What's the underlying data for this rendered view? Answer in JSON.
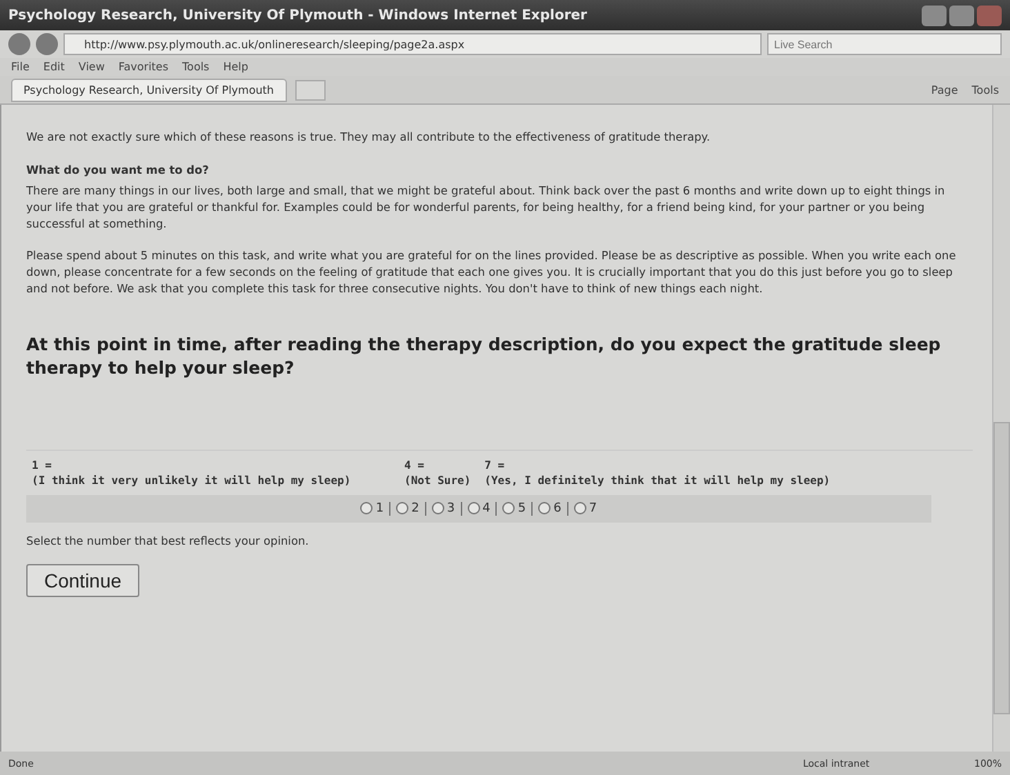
{
  "window": {
    "title": "Psychology Research, University Of Plymouth - Windows Internet Explorer"
  },
  "address_bar": {
    "url": "http://www.psy.plymouth.ac.uk/onlineresearch/sleeping/page2a.aspx",
    "search_placeholder": "Live Search"
  },
  "menu": [
    "File",
    "Edit",
    "View",
    "Favorites",
    "Tools",
    "Help"
  ],
  "tabs": [
    {
      "label": "Psychology Research, University Of Plymouth",
      "selected": true
    }
  ],
  "commands": [
    "Page",
    "Tools"
  ],
  "content": {
    "paragraph_1": "We are not exactly sure which of these reasons is true. They may all contribute to the effectiveness of gratitude therapy.",
    "heading": "What do you want me to do?",
    "paragraph_2": "There are many things in our lives, both large and small, that we might be grateful about. Think back over the past 6 months and write down up to eight things in your life that you are grateful or thankful for. Examples could be for wonderful parents, for being healthy, for a friend being kind, for your partner or you being successful at something.",
    "paragraph_3": "Please spend about 5 minutes on this task, and write what you are grateful for on the lines provided. Please be as descriptive as possible. When you write each one down, please concentrate for a few seconds on the feeling of gratitude that each one gives you. It is crucially important that you do this just before you go to sleep and not before. We ask that you complete this task for three consecutive nights. You don't have to think of new things each night.",
    "question": "At this point in time, after reading the therapy description, do you expect the gratitude sleep therapy to help your sleep?",
    "scale_anchors": [
      {
        "number": "1 =",
        "label": "(I think it very unlikely it will help my sleep)"
      },
      {
        "number": "4 =",
        "label": "(Not Sure)"
      },
      {
        "number": "7 =",
        "label": "(Yes, I definitely think that it will help my sleep)"
      }
    ],
    "options": [
      {
        "label": "1",
        "selected": false
      },
      {
        "label": "2",
        "selected": false
      },
      {
        "label": "3",
        "selected": false
      },
      {
        "label": "4",
        "selected": false
      },
      {
        "label": "5",
        "selected": false
      },
      {
        "label": "6",
        "selected": false
      },
      {
        "label": "7",
        "selected": false
      }
    ],
    "hint": "Select the number that best reflects your opinion.",
    "button": "Continue"
  },
  "status_bar": {
    "status": "Done",
    "zone": "Local intranet",
    "zoom": "100%"
  }
}
